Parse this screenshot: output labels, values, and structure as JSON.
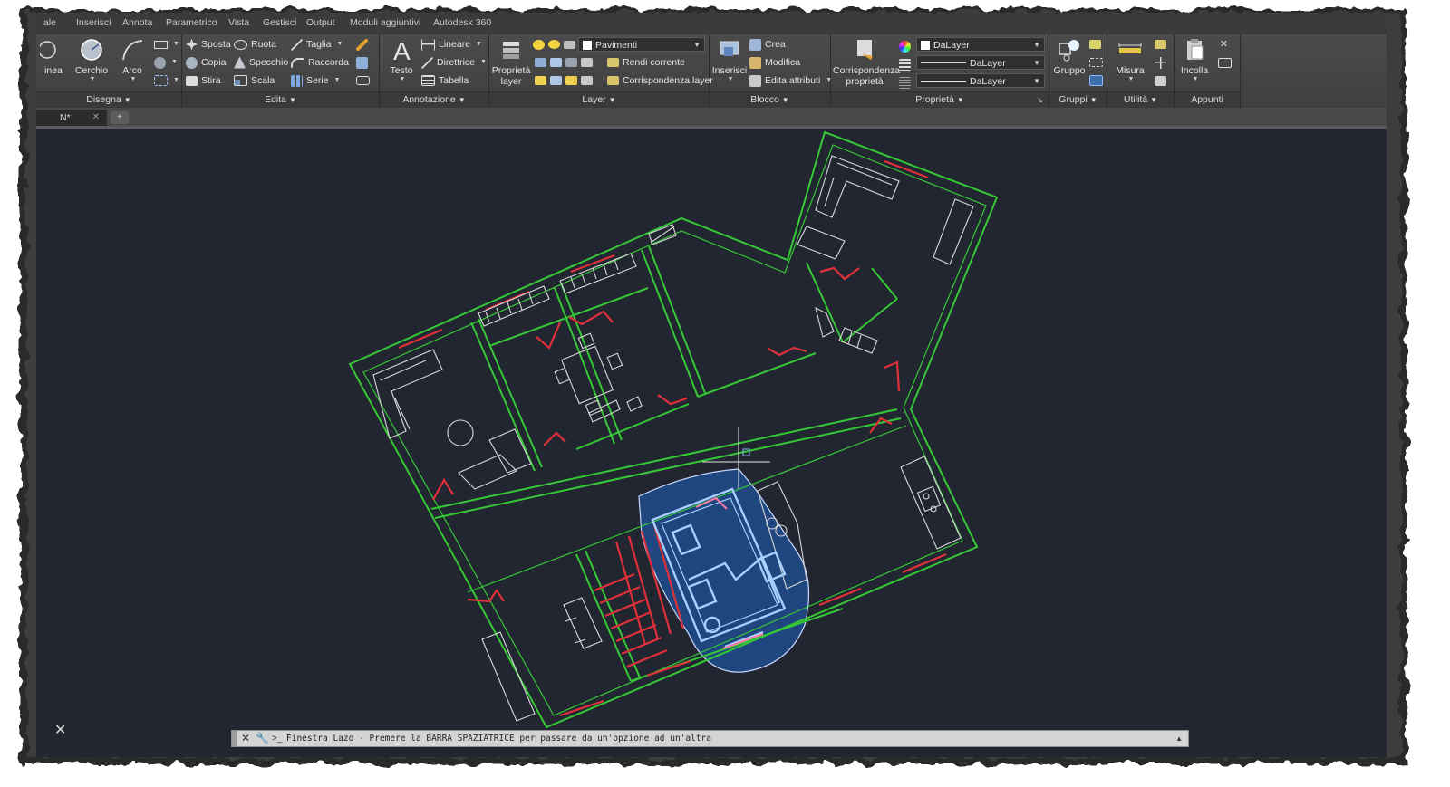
{
  "tabs": [
    {
      "label": "ale"
    },
    {
      "label": "Inserisci"
    },
    {
      "label": "Annota"
    },
    {
      "label": "Parametrico"
    },
    {
      "label": "Vista"
    },
    {
      "label": "Gestisci"
    },
    {
      "label": "Output"
    },
    {
      "label": "Moduli aggiuntivi"
    },
    {
      "label": "Autodesk 360"
    }
  ],
  "ribbon": {
    "draw": {
      "title": "Disegna",
      "line_label": "inea",
      "circle_label": "Cerchio",
      "arc_label": "Arco"
    },
    "modify": {
      "title": "Edita",
      "move": "Sposta",
      "rotate": "Ruota",
      "trim": "Taglia",
      "copy": "Copia",
      "mirror": "Specchio",
      "fillet": "Raccorda",
      "stretch": "Stira",
      "scale": "Scala",
      "array": "Serie"
    },
    "annotation": {
      "title": "Annotazione",
      "text": "Testo",
      "linear": "Lineare",
      "leader": "Direttrice",
      "table": "Tabella"
    },
    "layers": {
      "title": "Layer",
      "properties": "Proprietà layer",
      "current_layer": "Pavimenti",
      "make_current": "Rendi corrente",
      "match_layer": "Corrispondenza layer"
    },
    "block": {
      "title": "Blocco",
      "insert": "Inserisci",
      "create": "Crea",
      "edit": "Modifica",
      "edit_attributes": "Edita attributi"
    },
    "properties": {
      "title": "Proprietà",
      "match": "Corrispondenza proprietà",
      "color": "DaLayer",
      "lineweight": "DaLayer",
      "linetype": "DaLayer"
    },
    "groups": {
      "title": "Gruppi",
      "group": "Gruppo"
    },
    "utilities": {
      "title": "Utilità",
      "measure": "Misura"
    },
    "clipboard": {
      "title": "Appunti",
      "paste": "Incolla"
    }
  },
  "document": {
    "tab_label": "N*"
  },
  "command_line": {
    "text": "Finestra Lazo - Premere la BARRA SPAZIATRICE per passare da un'opzione ad un'altra"
  },
  "colors": {
    "walls": "#36c936",
    "openings": "#e0303a",
    "furniture": "#d8d8d8",
    "selection_fill": "#1f4c8c",
    "background": "#222631"
  },
  "icons": {
    "viewport_close": "close-icon",
    "cmd_close": "close-icon",
    "cmd_customize": "wrench-icon",
    "cmd_prompt": "prompt-icon"
  }
}
